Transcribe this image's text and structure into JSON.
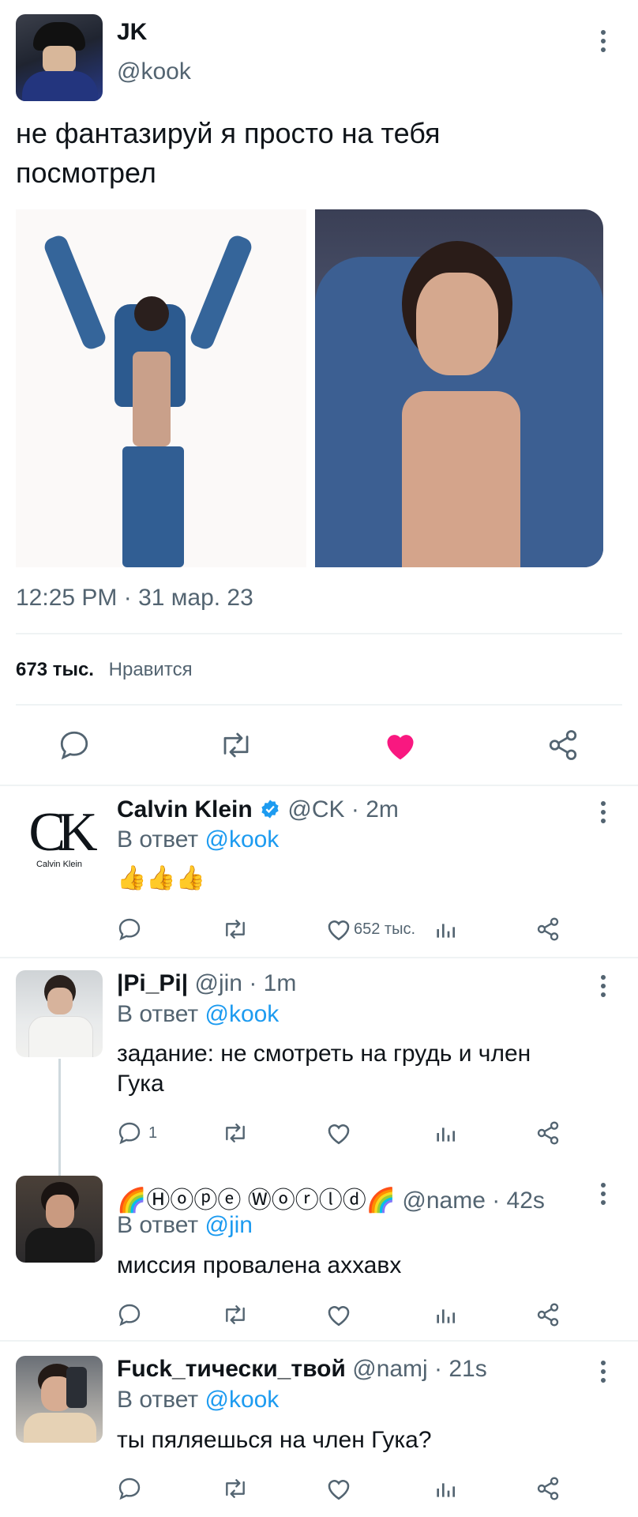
{
  "tweet": {
    "author_name": "JK",
    "author_handle": "@kook",
    "text_line1": "не фантазируй я просто на тебя",
    "text_line2": "посмотрел",
    "timestamp": "12:25 PM · 31 мар. 23",
    "likes_count": "673 тыс.",
    "likes_label": "Нравится",
    "liked": true
  },
  "replies": [
    {
      "name": "Calvin Klein",
      "verified": true,
      "handle": "@CK · 2m",
      "reply_prefix": "В ответ",
      "reply_to": "@kook",
      "text": "👍👍👍",
      "like_count": "652 тыс."
    },
    {
      "name": "|Pi_Pi|",
      "handle": "@jin · 1m",
      "reply_prefix": "В ответ",
      "reply_to": "@kook",
      "text_line1": "задание: не смотреть на грудь и член",
      "text_line2": "Гука",
      "reply_count": "1"
    },
    {
      "name": "🌈Ⓗⓞⓟⓔ Ⓦⓞⓡⓛⓓ🌈",
      "handle": "@name · 42s",
      "reply_prefix": "В ответ",
      "reply_to": "@jin",
      "text": "миссия провалена аххавх"
    },
    {
      "name": "Fuck_тически_твой",
      "handle": "@namj · 21s",
      "reply_prefix": "В ответ",
      "reply_to": "@kook",
      "text": "ты пяляешься на член Гука?"
    }
  ],
  "ck_logo": {
    "mark": "CK",
    "wordmark": "Calvin Klein"
  },
  "colors": {
    "accent": "#1d9bf0",
    "like": "#f91880",
    "muted": "#536471",
    "text": "#0f1419"
  }
}
